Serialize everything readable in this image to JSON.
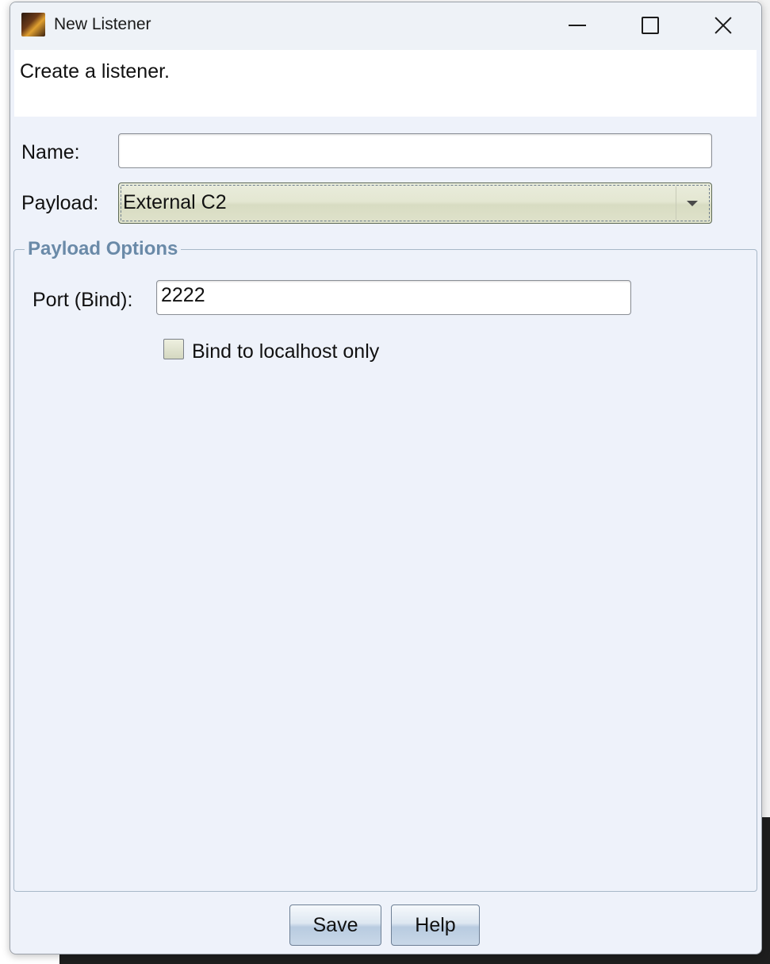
{
  "window": {
    "title": "New Listener"
  },
  "description": "Create a listener.",
  "form": {
    "name_label": "Name:",
    "name_value": "",
    "payload_label": "Payload:",
    "payload_value": "External C2"
  },
  "payload_options": {
    "group_title": "Payload Options",
    "port_label": "Port (Bind):",
    "port_value": "2222",
    "bind_localhost_label": "Bind to localhost only",
    "bind_localhost_checked": false
  },
  "buttons": {
    "save": "Save",
    "help": "Help"
  },
  "colors": {
    "window_bg": "#eef2fa",
    "group_title": "#6a8aa8",
    "combo_bg": "#e4e7d2"
  },
  "icons": {
    "app": "app-icon",
    "minimize": "minimize-icon",
    "maximize": "maximize-icon",
    "close": "close-icon",
    "dropdown": "chevron-down-icon"
  }
}
